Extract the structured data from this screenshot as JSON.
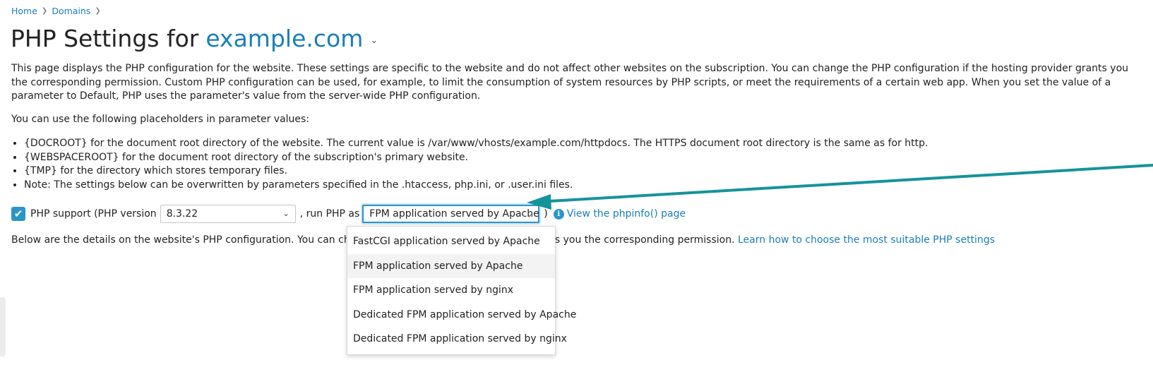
{
  "breadcrumb": {
    "items": [
      "Home",
      "Domains"
    ]
  },
  "header": {
    "title": "PHP Settings for",
    "domain": "example.com"
  },
  "intro_text": "This page displays the PHP configuration for the website. These settings are specific to the website and do not affect other websites on the subscription. You can change the PHP configuration if the hosting provider grants you the corresponding permission. Custom PHP configuration can be used, for example, to limit the consumption of system resources by PHP scripts, or meet the requirements of a certain web app. When you set the value of a parameter to Default, PHP uses the parameter's value from the server-wide PHP configuration.",
  "placeholders_text": "You can use the following placeholders in parameter values:",
  "placeholder_items": [
    "{DOCROOT} for the document root directory of the website. The current value is /var/www/vhosts/example.com/httpdocs. The HTTPS document root directory is the same as for http.",
    "{WEBSPACEROOT} for the document root directory of the subscription's primary website.",
    "{TMP} for the directory which stores temporary files.",
    "Note: The settings below can be overwritten by parameters specified in the .htaccess, php.ini, or .user.ini files."
  ],
  "php_row": {
    "support_label": "PHP support",
    "version_prefix": "(PHP version",
    "version_value": "8.3.22",
    "run_as_label": ", run PHP as",
    "run_as_value": "FPM application served by Apache",
    "close_paren": ")",
    "phpinfo_link": "View the phpinfo() page"
  },
  "details": {
    "text_start": "Below are the details on the website's PHP configuration. You can change th",
    "text_end": "nts you the corresponding permission.",
    "link": "Learn how to choose the most suitable PHP settings"
  },
  "dropdown": {
    "options": [
      "FastCGI application served by Apache",
      "FPM application served by Apache",
      "FPM application served by nginx",
      "Dedicated FPM application served by Apache",
      "Dedicated FPM application served by nginx"
    ],
    "selected": "FPM application served by Apache"
  },
  "colors": {
    "link": "#1a7fb5",
    "accent": "#2b95c8",
    "annotation_arrow": "#16939a"
  }
}
